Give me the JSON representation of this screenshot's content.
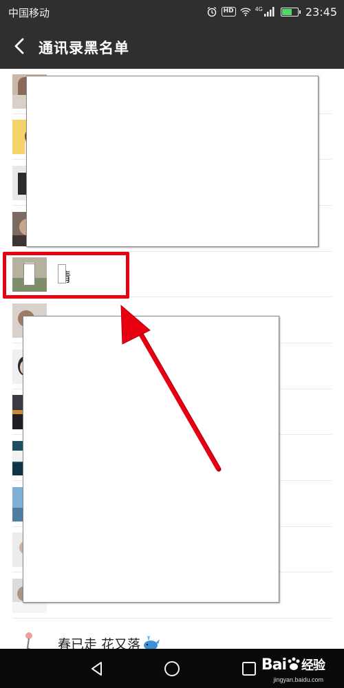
{
  "status_bar": {
    "carrier": "中国移动",
    "network": "4G",
    "time": "23:45",
    "battery_level": 0.6,
    "icons": [
      "alarm-icon",
      "hd-icon",
      "wifi-icon",
      "signal-icon",
      "battery-icon"
    ]
  },
  "header": {
    "title": "通讯录黑名单",
    "back_icon": "chevron-left-icon"
  },
  "contacts": [
    {
      "name": "",
      "avatar": "photo-avatar"
    },
    {
      "name": "",
      "avatar": "photo-avatar"
    },
    {
      "name": "",
      "avatar": "photo-avatar"
    },
    {
      "name": "",
      "avatar": "photo-avatar"
    },
    {
      "name": "倩",
      "avatar": "photo-avatar",
      "highlighted": true
    },
    {
      "name": "",
      "avatar": "photo-avatar"
    },
    {
      "name": "",
      "avatar": "photo-avatar"
    },
    {
      "name": "",
      "avatar": "photo-avatar"
    },
    {
      "name": "",
      "avatar": "photo-avatar"
    },
    {
      "name": "",
      "avatar": "photo-avatar"
    },
    {
      "name": "",
      "avatar": "photo-avatar"
    },
    {
      "name": "",
      "avatar": "photo-avatar"
    },
    {
      "name": "春已走 花又落",
      "avatar": "photo-avatar",
      "emoji": "whale-icon"
    }
  ],
  "nav_bar": {
    "back": "triangle-back-icon",
    "home": "circle-home-icon",
    "recent": "square-recent-icon"
  },
  "watermark": {
    "brand": "Bai",
    "brand_suffix": "经验",
    "url": "jingyan.baidu.com"
  },
  "colors": {
    "header_bg": "#2f2f2f",
    "highlight": "#e60012",
    "arrow": "#e60012",
    "nav_bg": "#0a0a0a"
  }
}
